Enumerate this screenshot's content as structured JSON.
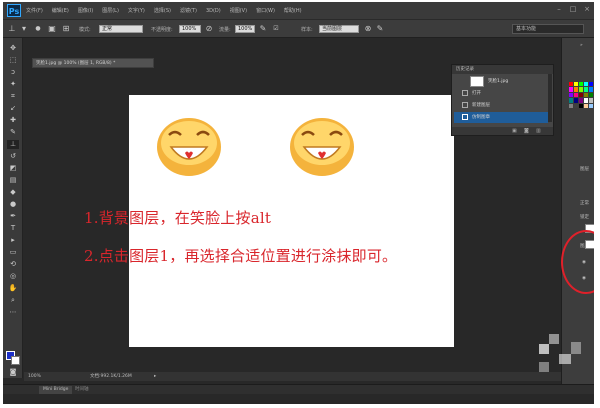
{
  "app": {
    "logo": "Ps"
  },
  "menu": [
    "文件(F)",
    "编辑(E)",
    "图像(I)",
    "图层(L)",
    "文字(Y)",
    "选择(S)",
    "滤镜(T)",
    "3D(D)",
    "视图(V)",
    "窗口(W)",
    "帮助(H)"
  ],
  "options": {
    "mode_label": "模式:",
    "mode_value": "正常",
    "opacity_label": "不透明度:",
    "opacity_value": "100%",
    "flow_label": "流量:",
    "flow_value": "100%",
    "sample_label": "样本:",
    "sample_value": "当前图层",
    "workspace": "基本功能"
  },
  "document": {
    "tab_title": "笑脸1.jpg @ 100% (图层 1, RGB/8) *"
  },
  "canvas_text": {
    "line1": "1.背景图层，在笑脸上按alt",
    "line2": "2.点击图层1，再选择合适位置进行涂抹即可。"
  },
  "history": {
    "title": "历史记录",
    "snapshot": "笑脸1.jpg",
    "items": [
      "打开",
      "新建图层",
      "仿制图章"
    ]
  },
  "right_panel": {
    "labels": [
      "图层",
      "正常",
      "锁定",
      "图层"
    ]
  },
  "status": {
    "zoom": "100%",
    "doc_size": "文档:992.1K/1.26M"
  },
  "bottom": {
    "tab1": "Mini Bridge",
    "tab2": "时间轴"
  },
  "colors": {
    "accent_red": "#d9262c",
    "selection_blue": "#1f5d9a",
    "fg_color": "#1c2fc9"
  },
  "swatches": [
    "#ff0000",
    "#ffff00",
    "#00ff00",
    "#00ffff",
    "#0000ff",
    "#ff00ff",
    "#ff8000",
    "#80ff00",
    "#00ff80",
    "#0080ff",
    "#8000ff",
    "#ff0080",
    "#800000",
    "#808000",
    "#008000",
    "#008080",
    "#000080",
    "#800080",
    "#ffffff",
    "#c0c0c0",
    "#808080",
    "#404040",
    "#000000",
    "#ffcc99",
    "#99ccff"
  ]
}
